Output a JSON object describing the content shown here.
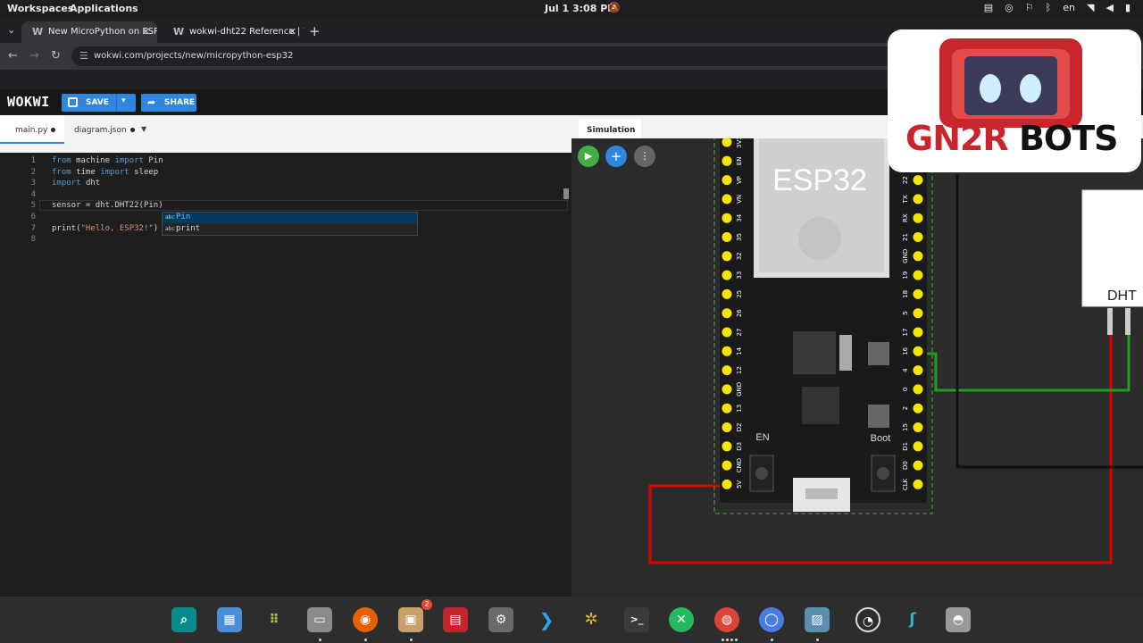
{
  "system_bar": {
    "workspaces": "Workspaces",
    "applications": "Applications",
    "clock": "Jul 1   3:08 PM",
    "locale": "en"
  },
  "browser": {
    "tabs": [
      {
        "label": "New MicroPython on ESP32 S",
        "favicon": "W"
      },
      {
        "label": "wokwi-dht22 Reference | Wo",
        "favicon": "W"
      }
    ],
    "url": "wokwi.com/projects/new/micropython-esp32"
  },
  "wokwi": {
    "logo": "WOKWI",
    "save_label": "SAVE",
    "share_label": "SHARE"
  },
  "editor": {
    "tabs": [
      {
        "label": "main.py"
      },
      {
        "label": "diagram.json"
      }
    ],
    "lines": [
      {
        "num": "1",
        "parts": [
          [
            "kw",
            "from"
          ],
          [
            "",
            "machine "
          ],
          [
            "kw",
            "import"
          ],
          [
            "",
            "Pin"
          ]
        ]
      },
      {
        "num": "2",
        "parts": [
          [
            "kw",
            "from"
          ],
          [
            "",
            "time "
          ],
          [
            "kw",
            "import"
          ],
          [
            "",
            "sleep"
          ]
        ]
      },
      {
        "num": "3",
        "parts": [
          [
            "kw",
            "import"
          ],
          [
            "",
            "dht"
          ]
        ]
      },
      {
        "num": "4",
        "parts": []
      },
      {
        "num": "5",
        "parts": [
          [
            "",
            "sensor = dht.DHT22(Pin)"
          ]
        ]
      },
      {
        "num": "6",
        "parts": []
      },
      {
        "num": "7",
        "parts": [
          [
            "",
            "print("
          ],
          [
            "str",
            "\"Hello, ESP32!\""
          ],
          [
            "",
            ")"
          ]
        ]
      },
      {
        "num": "8",
        "parts": []
      }
    ],
    "suggestions": [
      {
        "label": "Pin",
        "kind": "abc"
      },
      {
        "label": "print",
        "kind": "abc"
      }
    ]
  },
  "simulation": {
    "tab_label": "Simulation",
    "board_label": "ESP32",
    "en_label": "EN",
    "boot_label": "Boot",
    "sensor_label": "DHT",
    "left_pins": [
      "3V3",
      "EN",
      "VP",
      "VN",
      "34",
      "35",
      "32",
      "33",
      "25",
      "26",
      "27",
      "14",
      "12",
      "GND",
      "13",
      "D2",
      "D3",
      "CMD",
      "5V"
    ],
    "right_pins": [
      "GND",
      "23",
      "22",
      "TX",
      "RX",
      "21",
      "GND",
      "19",
      "18",
      "5",
      "17",
      "16",
      "4",
      "0",
      "2",
      "15",
      "D1",
      "D0",
      "CLK"
    ]
  },
  "overlay": {
    "brand_red": "GN2R",
    "brand_black": "BOTS"
  },
  "dock": {
    "notification_badge": "2"
  },
  "colors": {
    "accent": "#2e86de",
    "wire_red": "#e00000",
    "wire_green": "#1f9e1f",
    "board": "#1a1a1a",
    "pin": "#f5e600"
  }
}
